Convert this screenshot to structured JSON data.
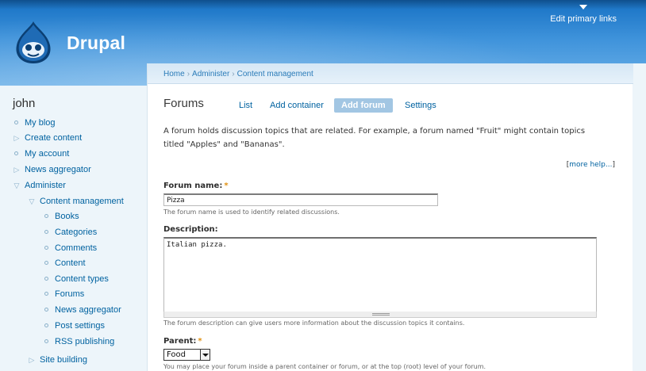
{
  "header": {
    "site_name": "Drupal",
    "primary_links": "Edit primary links"
  },
  "sidebar": {
    "user": "john",
    "items": [
      {
        "label": "My blog",
        "bullet": "circle"
      },
      {
        "label": "Create content",
        "bullet": "arrow-right"
      },
      {
        "label": "My account",
        "bullet": "circle"
      },
      {
        "label": "News aggregator",
        "bullet": "arrow-right"
      },
      {
        "label": "Administer",
        "bullet": "arrow-down"
      },
      {
        "label": "Content management",
        "bullet": "arrow-down"
      },
      {
        "label": "Books",
        "bullet": "circle"
      },
      {
        "label": "Categories",
        "bullet": "circle"
      },
      {
        "label": "Comments",
        "bullet": "circle"
      },
      {
        "label": "Content",
        "bullet": "circle"
      },
      {
        "label": "Content types",
        "bullet": "circle"
      },
      {
        "label": "Forums",
        "bullet": "circle"
      },
      {
        "label": "News aggregator",
        "bullet": "circle"
      },
      {
        "label": "Post settings",
        "bullet": "circle"
      },
      {
        "label": "RSS publishing",
        "bullet": "circle"
      },
      {
        "label": "Site building",
        "bullet": "arrow-right"
      }
    ]
  },
  "breadcrumb": [
    "Home",
    "Administer",
    "Content management"
  ],
  "page": {
    "title": "Forums",
    "tabs": [
      {
        "label": "List",
        "active": false
      },
      {
        "label": "Add container",
        "active": false
      },
      {
        "label": "Add forum",
        "active": true
      },
      {
        "label": "Settings",
        "active": false
      }
    ],
    "intro": "A forum holds discussion topics that are related. For example, a forum named \"Fruit\" might contain topics titled \"Apples\" and \"Bananas\".",
    "more_help": "more help..."
  },
  "form": {
    "forum_name": {
      "label": "Forum name:",
      "required": "*",
      "value": "Pizza",
      "hint": "The forum name is used to identify related discussions."
    },
    "description": {
      "label": "Description:",
      "value": "Italian pizza.",
      "hint": "The forum description can give users more information about the discussion topics it contains."
    },
    "parent": {
      "label": "Parent:",
      "required": "*",
      "value": "Food",
      "hint": "You may place your forum inside a parent container or forum, or at the top (root) level of your forum."
    }
  },
  "colors": {
    "link": "#0062a0",
    "required": "#e09010",
    "header_dark": "#0f4f8c",
    "header_light": "#6bb0e8",
    "active_tab": "#a2c6e3"
  }
}
